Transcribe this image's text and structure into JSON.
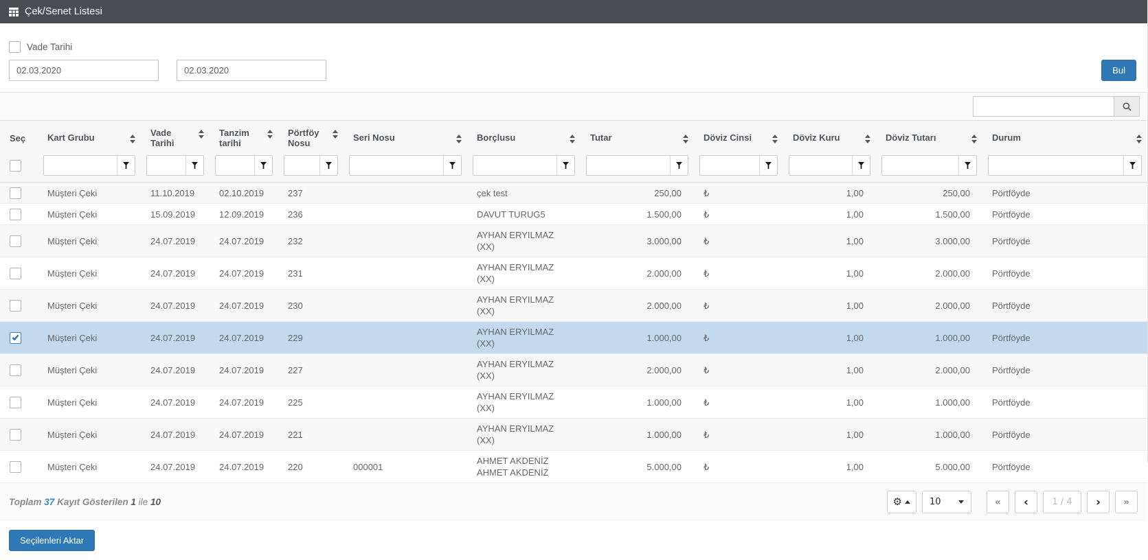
{
  "panel": {
    "title": "Çek/Senet Listesi"
  },
  "filter_bar": {
    "vade_tarihi_label": "Vade Tarihi",
    "date_from": "02.03.2020",
    "date_to": "02.03.2020",
    "bul_button": "Bul"
  },
  "search": {
    "value": ""
  },
  "table": {
    "columns": [
      {
        "key": "select",
        "label": "Seç",
        "sortable": false
      },
      {
        "key": "kart_grubu",
        "label": "Kart Grubu",
        "sortable": true
      },
      {
        "key": "vade_tarihi",
        "label": "Vade Tarihi",
        "sortable": true
      },
      {
        "key": "tanzim_tarihi",
        "label": "Tanzim tarihi",
        "sortable": true
      },
      {
        "key": "portfoy_nosu",
        "label": "Pörtföy Nosu",
        "sortable": true
      },
      {
        "key": "seri_nosu",
        "label": "Seri Nosu",
        "sortable": true
      },
      {
        "key": "borclusu",
        "label": "Borçlusu",
        "sortable": true
      },
      {
        "key": "tutar",
        "label": "Tutar",
        "sortable": true
      },
      {
        "key": "doviz_cinsi",
        "label": "Döviz Cinsi",
        "sortable": true
      },
      {
        "key": "doviz_kuru",
        "label": "Döviz Kuru",
        "sortable": true
      },
      {
        "key": "doviz_tutari",
        "label": "Döviz Tutarı",
        "sortable": true
      },
      {
        "key": "durum",
        "label": "Durum",
        "sortable": true
      }
    ],
    "rows": [
      {
        "selected": false,
        "kart_grubu": "Müşteri Çeki",
        "vade_tarihi": "11.10.2019",
        "tanzim_tarihi": "02.10.2019",
        "portfoy_nosu": "237",
        "seri_nosu": "",
        "borclusu": "çek test",
        "tutar": "250,00",
        "doviz_cinsi": "₺",
        "doviz_kuru": "1,00",
        "doviz_tutari": "250,00",
        "durum": "Pörtföyde"
      },
      {
        "selected": false,
        "kart_grubu": "Müşteri Çeki",
        "vade_tarihi": "15.09.2019",
        "tanzim_tarihi": "12.09.2019",
        "portfoy_nosu": "236",
        "seri_nosu": "",
        "borclusu": "DAVUT TURUG5",
        "tutar": "1.500,00",
        "doviz_cinsi": "₺",
        "doviz_kuru": "1,00",
        "doviz_tutari": "1.500,00",
        "durum": "Pörtföyde"
      },
      {
        "selected": false,
        "kart_grubu": "Müşteri Çeki",
        "vade_tarihi": "24.07.2019",
        "tanzim_tarihi": "24.07.2019",
        "portfoy_nosu": "232",
        "seri_nosu": "",
        "borclusu": "AYHAN ERYILMAZ (XX)",
        "tutar": "3.000,00",
        "doviz_cinsi": "₺",
        "doviz_kuru": "1,00",
        "doviz_tutari": "3.000,00",
        "durum": "Pörtföyde"
      },
      {
        "selected": false,
        "kart_grubu": "Müşteri Çeki",
        "vade_tarihi": "24.07.2019",
        "tanzim_tarihi": "24.07.2019",
        "portfoy_nosu": "231",
        "seri_nosu": "",
        "borclusu": "AYHAN ERYILMAZ (XX)",
        "tutar": "2.000,00",
        "doviz_cinsi": "₺",
        "doviz_kuru": "1,00",
        "doviz_tutari": "2.000,00",
        "durum": "Pörtföyde"
      },
      {
        "selected": false,
        "kart_grubu": "Müşteri Çeki",
        "vade_tarihi": "24.07.2019",
        "tanzim_tarihi": "24.07.2019",
        "portfoy_nosu": "230",
        "seri_nosu": "",
        "borclusu": "AYHAN ERYILMAZ (XX)",
        "tutar": "2.000,00",
        "doviz_cinsi": "₺",
        "doviz_kuru": "1,00",
        "doviz_tutari": "2.000,00",
        "durum": "Pörtföyde"
      },
      {
        "selected": true,
        "kart_grubu": "Müşteri Çeki",
        "vade_tarihi": "24.07.2019",
        "tanzim_tarihi": "24.07.2019",
        "portfoy_nosu": "229",
        "seri_nosu": "",
        "borclusu": "AYHAN ERYILMAZ (XX)",
        "tutar": "1.000,00",
        "doviz_cinsi": "₺",
        "doviz_kuru": "1,00",
        "doviz_tutari": "1.000,00",
        "durum": "Pörtföyde"
      },
      {
        "selected": false,
        "kart_grubu": "Müşteri Çeki",
        "vade_tarihi": "24.07.2019",
        "tanzim_tarihi": "24.07.2019",
        "portfoy_nosu": "227",
        "seri_nosu": "",
        "borclusu": "AYHAN ERYILMAZ (XX)",
        "tutar": "2.000,00",
        "doviz_cinsi": "₺",
        "doviz_kuru": "1,00",
        "doviz_tutari": "2.000,00",
        "durum": "Pörtföyde"
      },
      {
        "selected": false,
        "kart_grubu": "Müşteri Çeki",
        "vade_tarihi": "24.07.2019",
        "tanzim_tarihi": "24.07.2019",
        "portfoy_nosu": "225",
        "seri_nosu": "",
        "borclusu": "AYHAN ERYILMAZ (XX)",
        "tutar": "1.000,00",
        "doviz_cinsi": "₺",
        "doviz_kuru": "1,00",
        "doviz_tutari": "1.000,00",
        "durum": "Pörtföyde"
      },
      {
        "selected": false,
        "kart_grubu": "Müşteri Çeki",
        "vade_tarihi": "24.07.2019",
        "tanzim_tarihi": "24.07.2019",
        "portfoy_nosu": "221",
        "seri_nosu": "",
        "borclusu": "AYHAN ERYILMAZ (XX)",
        "tutar": "1.000,00",
        "doviz_cinsi": "₺",
        "doviz_kuru": "1,00",
        "doviz_tutari": "1.000,00",
        "durum": "Pörtföyde"
      },
      {
        "selected": false,
        "kart_grubu": "Müşteri Çeki",
        "vade_tarihi": "24.07.2019",
        "tanzim_tarihi": "24.07.2019",
        "portfoy_nosu": "220",
        "seri_nosu": "000001",
        "borclusu": "AHMET AKDENİZ\nAHMET AKDENİZ",
        "tutar": "5.000,00",
        "doviz_cinsi": "₺",
        "doviz_kuru": "1,00",
        "doviz_tutari": "5.000,00",
        "durum": "Pörtföyde"
      }
    ]
  },
  "footer": {
    "summary": {
      "toplam_label": "Toplam",
      "total_records": "37",
      "shown_label": "Kayıt Gösterilen",
      "from": "1",
      "ile_label": "ile",
      "to": "10"
    },
    "page_size": "10",
    "page_indicator": "1 / 4",
    "nav": {
      "first": "«",
      "prev": "‹",
      "next": "›",
      "last": "»"
    }
  },
  "actions": {
    "transfer_button": "Seçilenleri Aktar"
  },
  "colors": {
    "titlebar_bg": "#484d52",
    "accent_blue": "#2e78b5",
    "selected_row_bg": "#c3d9ee",
    "summary_link_blue": "#3786c3"
  }
}
